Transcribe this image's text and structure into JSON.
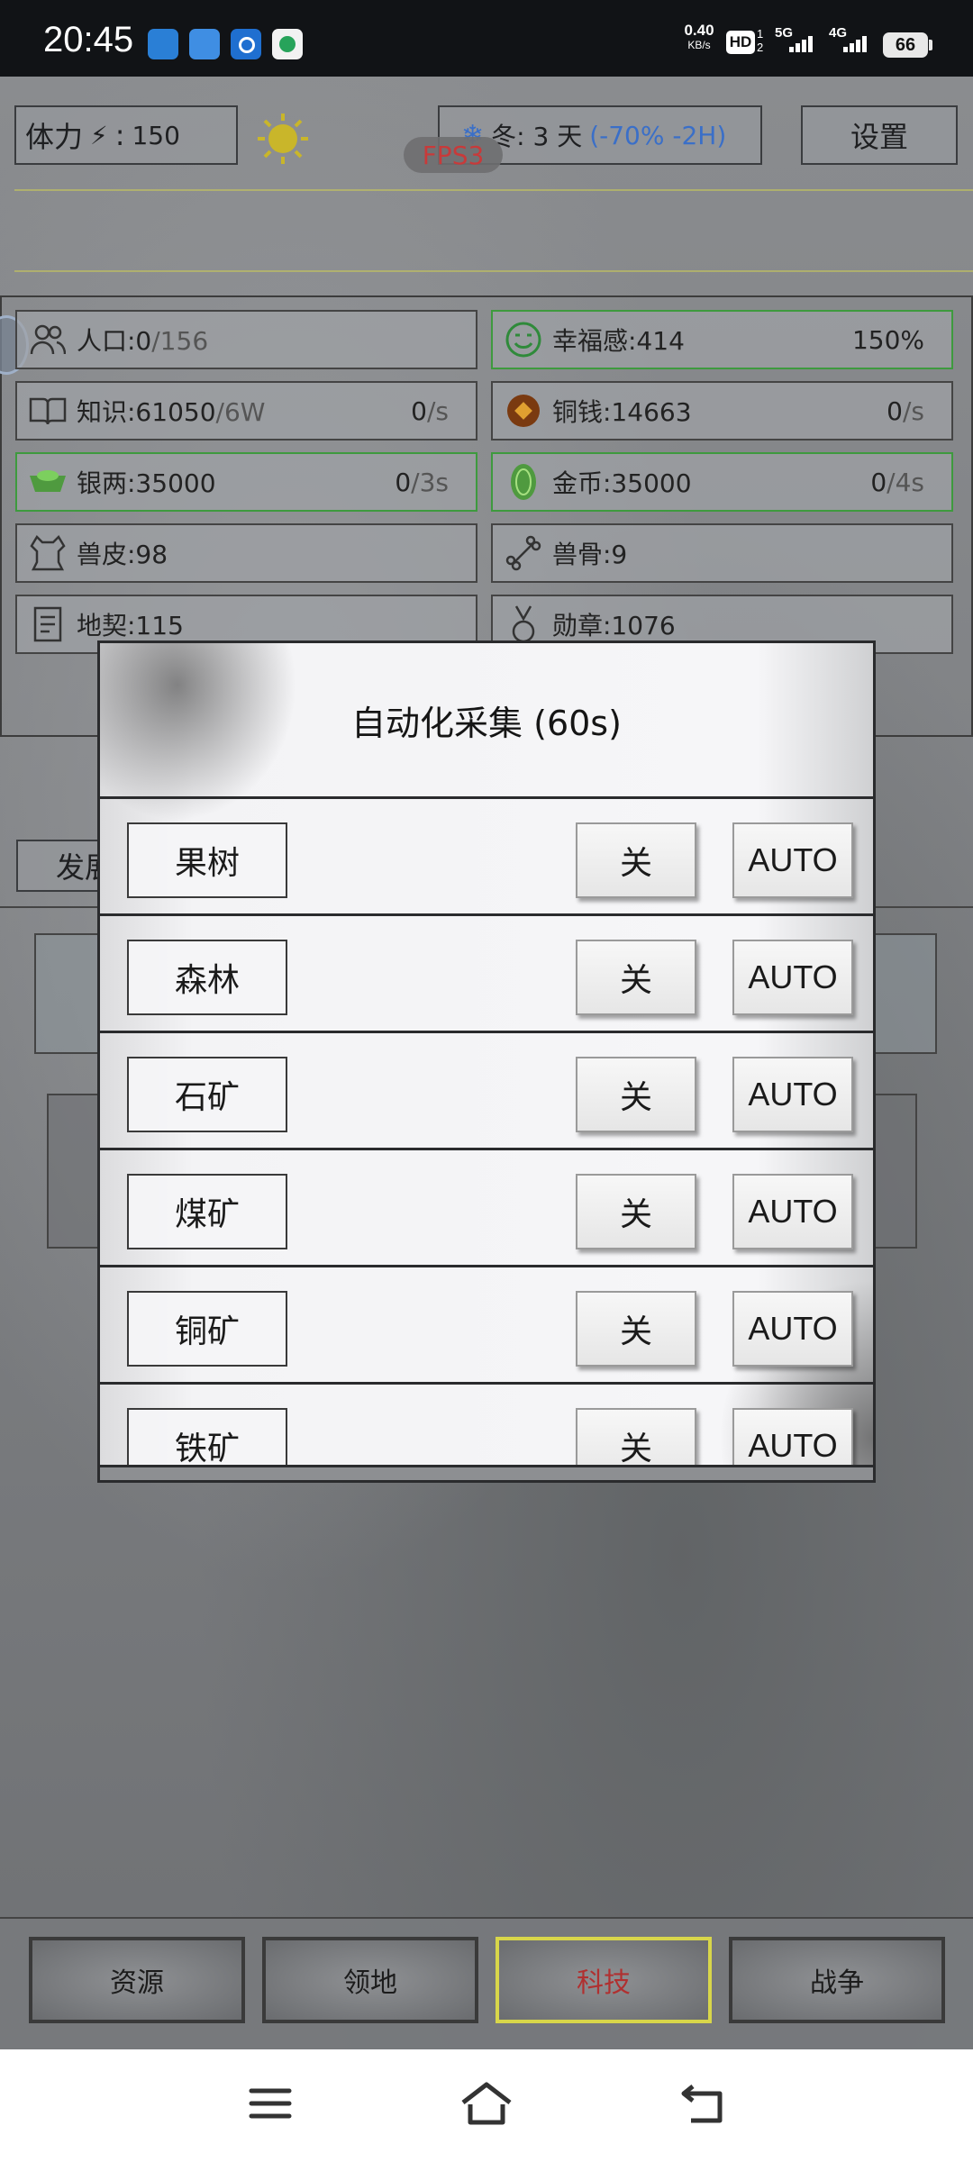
{
  "status_bar": {
    "time": "20:45",
    "net_speed_value": "0.40",
    "net_speed_unit": "KB/s",
    "hd_label": "HD",
    "sim1": "1",
    "sim2": "2",
    "signal1": "5G",
    "signal2": "4G",
    "battery": "66"
  },
  "header": {
    "stamina_label": "体力",
    "stamina_sep": ":",
    "stamina_value": "150",
    "season": "冬: 3 天",
    "season_modifier": "(-70% -2H)",
    "fps": "FPS3",
    "settings_label": "设置"
  },
  "resources": [
    {
      "label": "人口:0",
      "label_suffix": "/156",
      "rate": "",
      "green": false
    },
    {
      "label": "幸福感:414",
      "label_suffix": "",
      "rate": "150%",
      "green": true
    },
    {
      "label": "知识:61050",
      "label_suffix": "/6W",
      "rate": "0",
      "rate_suffix": "/s",
      "green": false
    },
    {
      "label": "铜钱:14663",
      "label_suffix": "",
      "rate": "0",
      "rate_suffix": "/s",
      "green": false
    },
    {
      "label": "银两:35000",
      "label_suffix": "",
      "rate": "0",
      "rate_suffix": "/3s",
      "green": true
    },
    {
      "label": "金币:35000",
      "label_suffix": "",
      "rate": "0",
      "rate_suffix": "/4s",
      "green": true
    },
    {
      "label": "兽皮:98",
      "green": false
    },
    {
      "label": "兽骨:9",
      "green": false
    },
    {
      "label": "地契:115",
      "green": false
    },
    {
      "label": "勋章:1076",
      "green": false
    }
  ],
  "partial_tab_label": "发展",
  "dialog": {
    "title": "自动化采集 (60s)",
    "rows": [
      {
        "name": "果树",
        "off": "关",
        "auto": "AUTO"
      },
      {
        "name": "森林",
        "off": "关",
        "auto": "AUTO"
      },
      {
        "name": "石矿",
        "off": "关",
        "auto": "AUTO"
      },
      {
        "name": "煤矿",
        "off": "关",
        "auto": "AUTO"
      },
      {
        "name": "铜矿",
        "off": "关",
        "auto": "AUTO"
      },
      {
        "name": "铁矿",
        "off": "关",
        "auto": "AUTO"
      }
    ]
  },
  "tabs": [
    {
      "label": "资源"
    },
    {
      "label": "领地"
    },
    {
      "label": "科技",
      "active": true
    },
    {
      "label": "战争"
    }
  ],
  "colors": {
    "accent_yellow": "#d8d64a",
    "active_tab_text": "#b03030",
    "green_border": "#3e9a3e",
    "fps_red": "#c83a3a",
    "season_blue": "#3a6fc8"
  }
}
